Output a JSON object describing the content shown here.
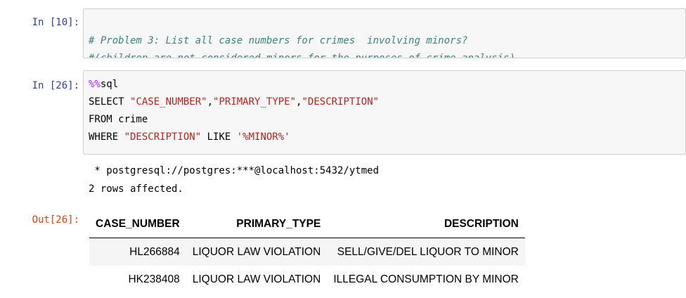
{
  "cells": [
    {
      "prompt": "In [10]:",
      "lines": [
        "# Problem 3: List all case numbers for crimes  involving minors?",
        "#(children are not considered minors for the purposes of crime analysis)"
      ]
    },
    {
      "prompt": "In [26]:",
      "magic": "%%",
      "magic_cmd": "sql",
      "select_kw": "SELECT ",
      "col1": "\"CASE_NUMBER\"",
      "sep1": ",",
      "col2": "\"PRIMARY_TYPE\"",
      "sep2": ",",
      "col3": "\"DESCRIPTION\"",
      "from_line": "FROM crime",
      "where_kw": "WHERE ",
      "where_col": "\"DESCRIPTION\"",
      "like_kw": " LIKE ",
      "like_val": "'%MINOR%'"
    }
  ],
  "output": {
    "connection": " * postgresql://postgres:***@localhost:5432/ytmed",
    "rows_affected": "2 rows affected.",
    "prompt": "Out[26]:",
    "table": {
      "headers": [
        "CASE_NUMBER",
        "PRIMARY_TYPE",
        "DESCRIPTION"
      ],
      "rows": [
        [
          "HL266884",
          "LIQUOR LAW VIOLATION",
          "SELL/GIVE/DEL LIQUOR TO MINOR"
        ],
        [
          "HK238408",
          "LIQUOR LAW VIOLATION",
          "ILLEGAL CONSUMPTION BY MINOR"
        ]
      ]
    }
  }
}
